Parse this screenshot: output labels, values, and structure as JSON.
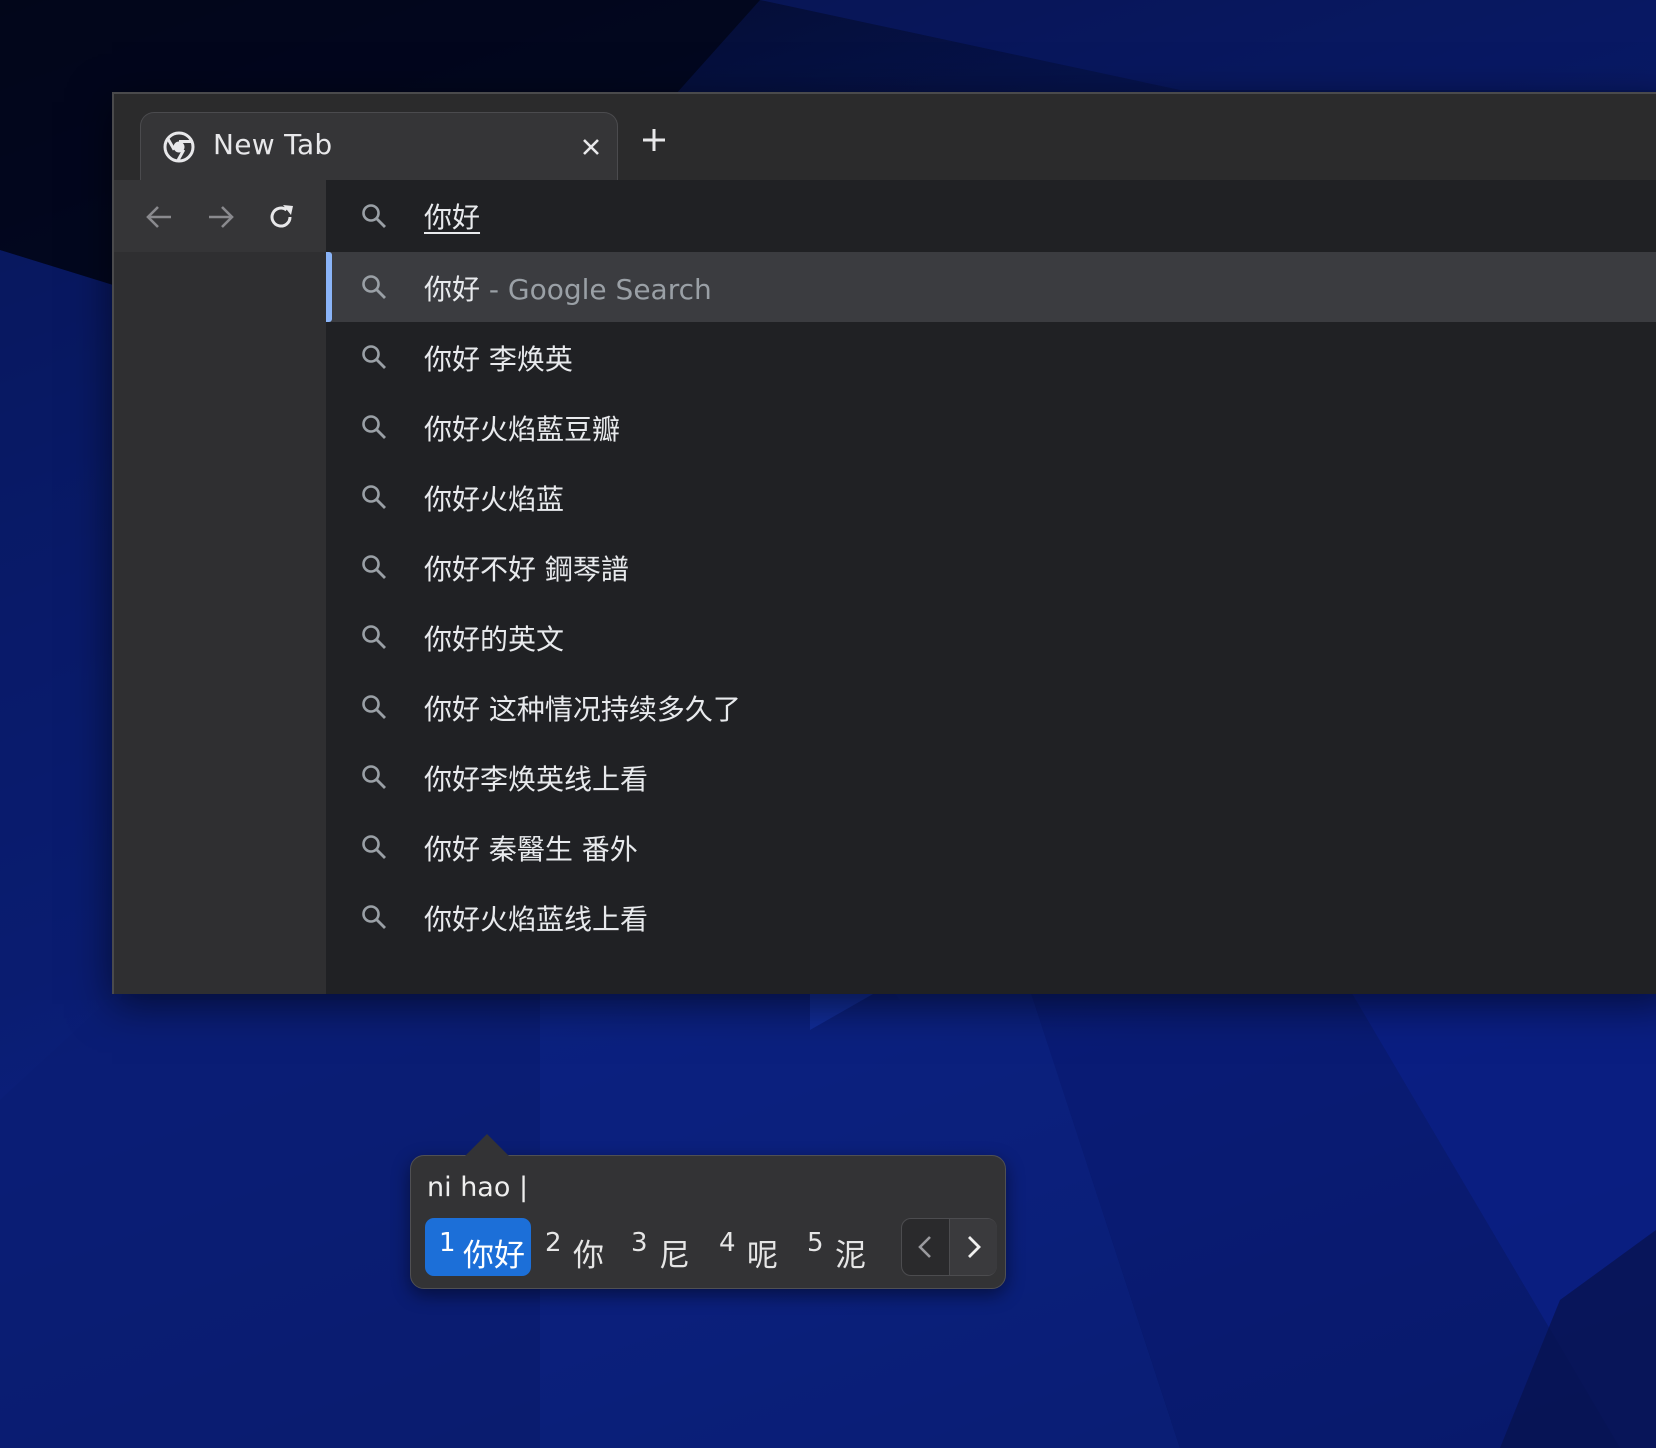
{
  "browser": {
    "tab": {
      "title": "New Tab",
      "icon": "chrome-logo-icon"
    },
    "toolbar": {
      "back_icon": "arrow-left-icon",
      "forward_icon": "arrow-right-icon",
      "reload_icon": "reload-icon"
    }
  },
  "omnibox": {
    "input_value": "你好",
    "suggestions": [
      {
        "text": "你好",
        "suffix": " - Google Search",
        "selected": true
      },
      {
        "text": "你好 李焕英"
      },
      {
        "text": "你好火焰藍豆瓣"
      },
      {
        "text": "你好火焰蓝"
      },
      {
        "text": "你好不好 鋼琴譜"
      },
      {
        "text": "你好的英文"
      },
      {
        "text": "你好 这种情况持续多久了"
      },
      {
        "text": "你好李焕英线上看"
      },
      {
        "text": "你好 秦醫生 番外"
      },
      {
        "text": "你好火焰蓝线上看"
      }
    ]
  },
  "ime": {
    "preedit": "ni hao |",
    "candidates": [
      {
        "num": "1",
        "text": "你好",
        "active": true
      },
      {
        "num": "2",
        "text": "你"
      },
      {
        "num": "3",
        "text": "尼"
      },
      {
        "num": "4",
        "text": "呢"
      },
      {
        "num": "5",
        "text": "泥"
      }
    ],
    "colors": {
      "active": "#1c6fd8",
      "popup_bg": "#333335"
    }
  },
  "colors": {
    "accent": "#8ab4f8",
    "dropdown_bg": "#202124",
    "selected_row": "#3b3c40"
  }
}
